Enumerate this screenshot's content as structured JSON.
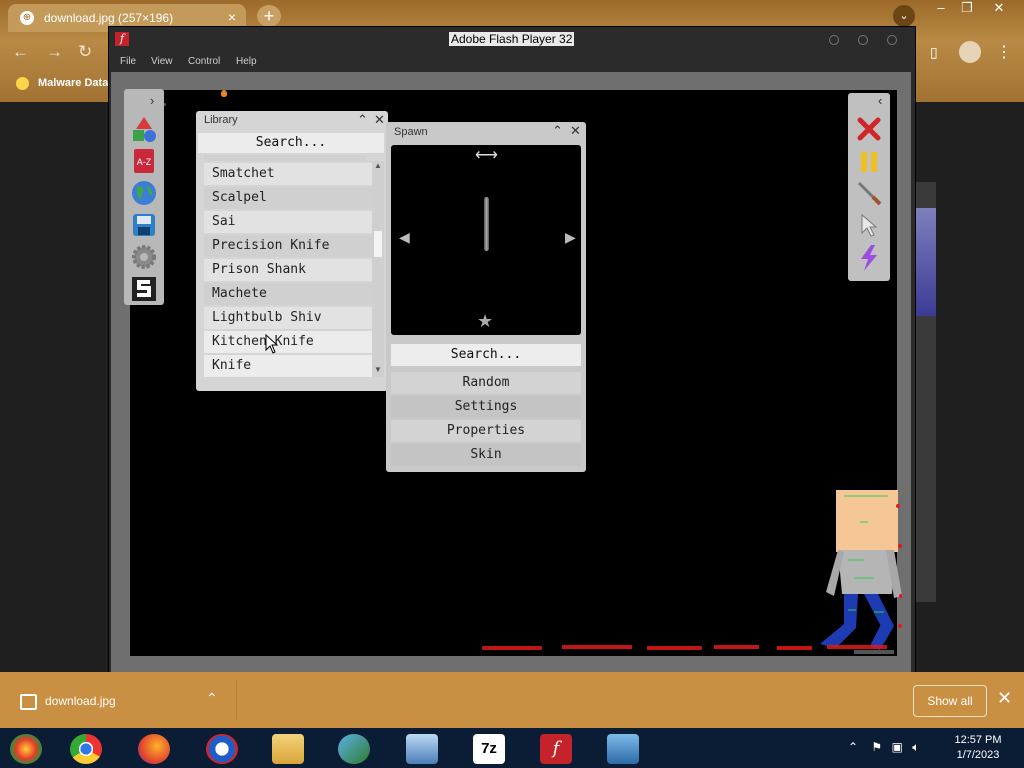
{
  "browser": {
    "tab_title": "download.jpg (257×196)",
    "tab_close": "×",
    "new_tab": "+",
    "bookmark": "Malware Data"
  },
  "flash": {
    "title": "Adobe Flash Player 32",
    "menu": [
      "File",
      "View",
      "Control",
      "Help"
    ]
  },
  "library": {
    "title": "Library",
    "search_placeholder": "Search...",
    "items": [
      "Smatchet",
      "Scalpel",
      "Sai",
      "Precision Knife",
      "Prison Shank",
      "Machete",
      "Lightbulb Shiv",
      "Kitchen Knife",
      "Knife"
    ]
  },
  "spawn": {
    "title": "Spawn",
    "search_placeholder": "Search...",
    "options": [
      "Random",
      "Settings",
      "Properties",
      "Skin"
    ]
  },
  "downloads": {
    "file": "download.jpg",
    "show_all": "Show all"
  },
  "taskbar": {
    "seven_zip": "7z",
    "time": "12:57 PM",
    "date": "1/7/2023"
  },
  "colors": {
    "chrome_theme": "#a77434",
    "taskbar": "#0b1d35",
    "flash_red": "#c5232b",
    "blood_red": "#e01a1a"
  }
}
